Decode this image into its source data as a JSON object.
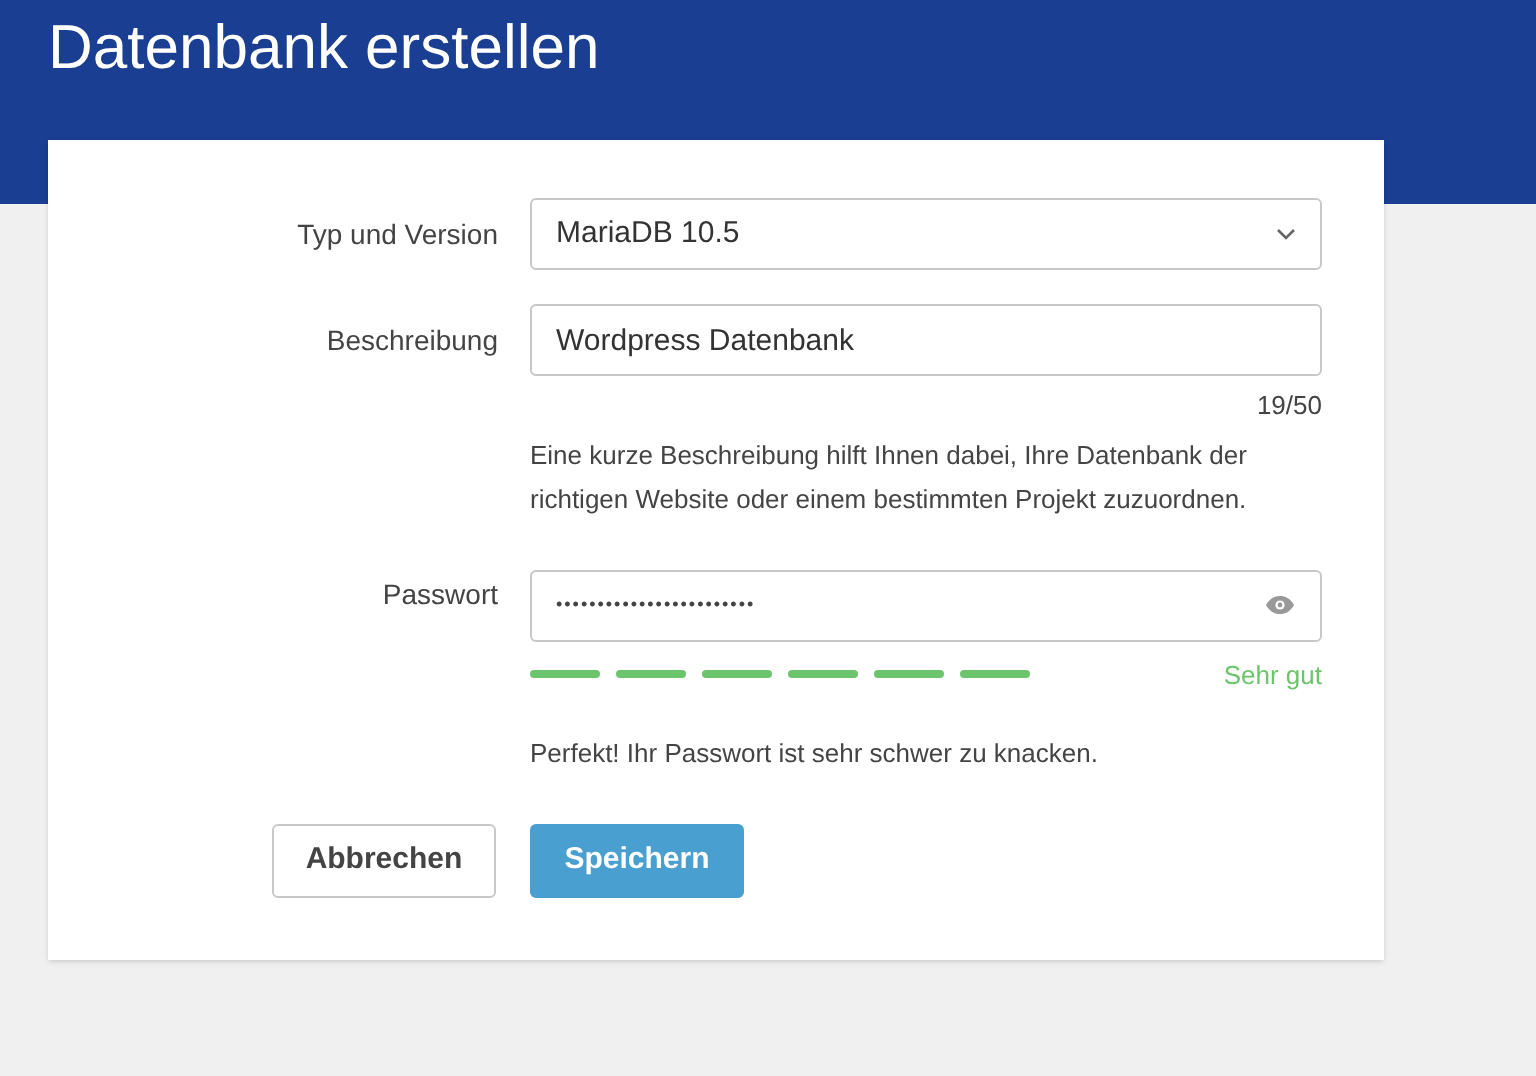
{
  "header": {
    "title": "Datenbank erstellen"
  },
  "form": {
    "type_version": {
      "label": "Typ und Version",
      "value": "MariaDB 10.5"
    },
    "description": {
      "label": "Beschreibung",
      "value": "Wordpress Datenbank",
      "counter": "19/50",
      "help": "Eine kurze Beschreibung hilft Ihnen dabei, Ihre Datenbank der richtigen Website oder einem bestimmten Projekt zuzuordnen."
    },
    "password": {
      "label": "Passwort",
      "value": "••••••••••••••••••••••••",
      "strength": {
        "segments": [
          {
            "filled": true
          },
          {
            "filled": true
          },
          {
            "filled": true
          },
          {
            "filled": true
          },
          {
            "filled": true
          },
          {
            "filled": true
          }
        ],
        "rating": "Sehr gut"
      },
      "message": "Perfekt! Ihr Passwort ist sehr schwer zu knacken."
    }
  },
  "buttons": [
    {
      "kind": "secondary",
      "label": "Abbrechen"
    },
    {
      "kind": "primary",
      "label": "Speichern"
    }
  ]
}
